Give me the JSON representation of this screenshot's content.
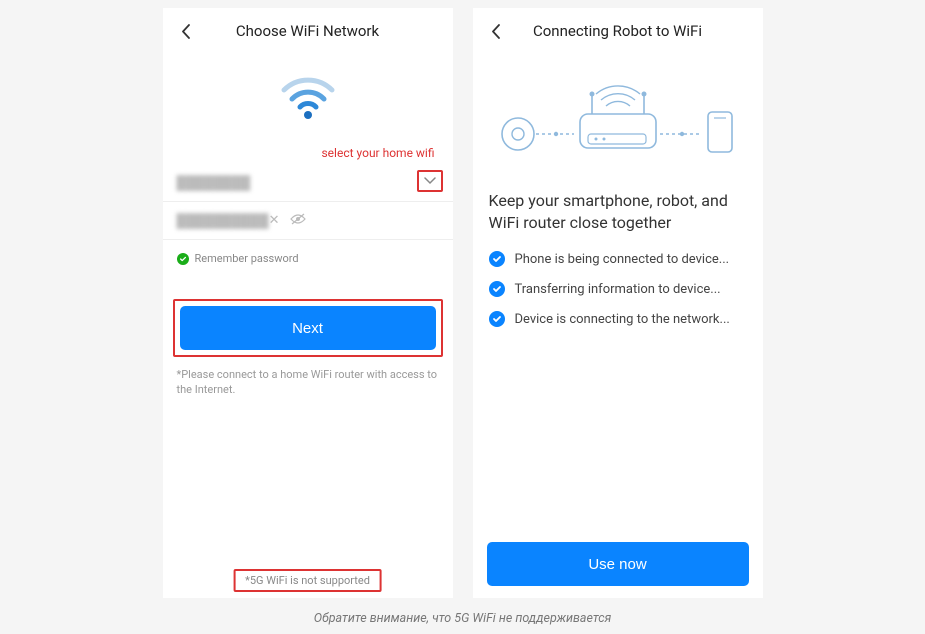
{
  "screen1": {
    "title": "Choose WiFi Network",
    "hint": "select your home wifi",
    "ssid_blur": "████████",
    "password_blur": "██████████",
    "remember_label": "Remember password",
    "next_label": "Next",
    "connect_note": "*Please connect to a home WiFi router with access to the Internet.",
    "warning_5g": "*5G WiFi is not supported"
  },
  "screen2": {
    "title": "Connecting Robot to WiFi",
    "heading": "Keep your smartphone, robot, and WiFi router close together",
    "status": [
      "Phone is being connected to device...",
      "Transferring information to device...",
      "Device is connecting to the network..."
    ],
    "use_now_label": "Use now"
  },
  "caption": "Обратите внимание, что 5G WiFi не поддерживается"
}
